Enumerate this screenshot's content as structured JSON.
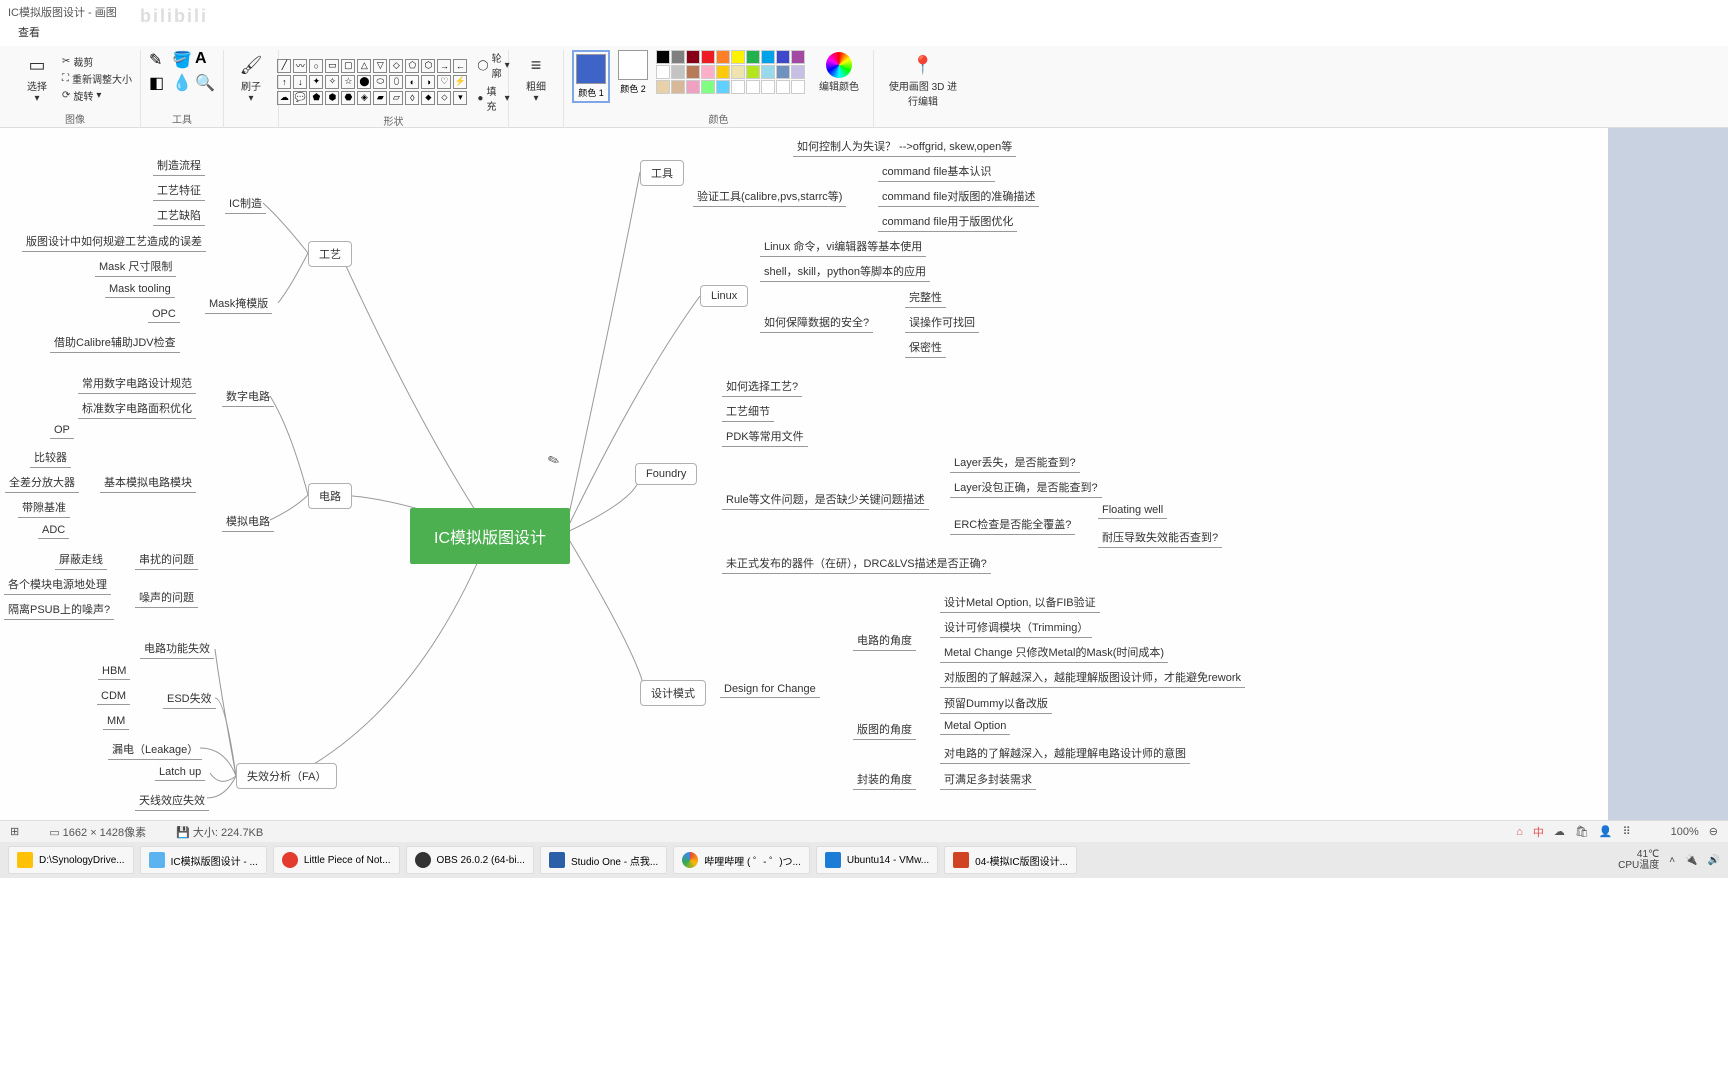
{
  "window": {
    "title": "IC模拟版图设计 - 画图"
  },
  "tabbar": {
    "view": "查看"
  },
  "watermark": "bilibili",
  "ribbon": {
    "image": {
      "label": "图像",
      "select": "选择",
      "crop": "裁剪",
      "resize": "重新调整大小",
      "rotate": "旋转"
    },
    "tools": {
      "label": "工具"
    },
    "shapes": {
      "label": "形状",
      "outline": "轮廓",
      "fill": "填充"
    },
    "brush": {
      "label": "刷子"
    },
    "thickness": {
      "label": "粗细"
    },
    "color1": {
      "heading": "颜色 1",
      "box": "#3e64c8"
    },
    "color2": {
      "heading": "颜色 2",
      "box": "#ffffff"
    },
    "colors": {
      "label": "颜色",
      "edit": "编辑颜色"
    },
    "paint3d": {
      "label": "使用画图 3D 进行编辑"
    }
  },
  "palette": [
    "#000000",
    "#7f7f7f",
    "#880015",
    "#ed1c24",
    "#ff7f27",
    "#fff200",
    "#22b14c",
    "#00a2e8",
    "#3f48cc",
    "#a349a4",
    "#ffffff",
    "#c3c3c3",
    "#b97a57",
    "#ffaec9",
    "#ffc90e",
    "#efe4b0",
    "#b5e61d",
    "#99d9ea",
    "#7092be",
    "#c8bfe7",
    "#e8d0a9",
    "#d7b899",
    "#f0a0c0",
    "#80ff80",
    "#60d0ff",
    "#ffffff",
    "#ffffff",
    "#ffffff",
    "#ffffff",
    "#ffffff"
  ],
  "mindmap": {
    "center": "IC模拟版图设计",
    "left": {
      "gy": {
        "node": "工艺",
        "ic": {
          "label": "IC制造",
          "items": [
            "制造流程",
            "工艺特征",
            "工艺缺陷",
            "版图设计中如何规避工艺造成的误差"
          ]
        },
        "mask": {
          "label": "Mask掩模版",
          "items": [
            "Mask 尺寸限制",
            "Mask tooling",
            "OPC",
            "借助Calibre辅助JDV检查"
          ]
        }
      },
      "dl": {
        "node": "电路",
        "digital": {
          "label": "数字电路",
          "items": [
            "常用数字电路设计规范",
            "标准数字电路面积优化"
          ]
        },
        "analog": {
          "label": "模拟电路",
          "basic": {
            "label": "基本模拟电路模块",
            "items": [
              "OP",
              "比较器",
              "全差分放大器",
              "带隙基准",
              "ADC"
            ]
          },
          "crosstalk": {
            "label": "串扰的问题",
            "items": [
              "屏蔽走线",
              "各个模块电源地处理"
            ]
          },
          "noise": {
            "label": "噪声的问题",
            "items": [
              "隔离PSUB上的噪声?"
            ]
          }
        }
      },
      "fa": {
        "node": "失效分析（FA）",
        "circuit": "电路功能失效",
        "esd": {
          "label": "ESD失效",
          "items": [
            "HBM",
            "CDM",
            "MM"
          ]
        },
        "leak": "漏电（Leakage）",
        "latch": "Latch up",
        "ant": "天线效应失效"
      }
    },
    "right": {
      "tool": {
        "node": "工具",
        "human": "如何控制人为失误？ -->offgrid, skew,open等",
        "verify": {
          "label": "验证工具(calibre,pvs,starrc等)",
          "items": [
            "command file基本认识",
            "command file对版图的准确描述",
            "command file用于版图优化"
          ]
        }
      },
      "linux": {
        "node": "Linux",
        "items": [
          "Linux 命令，vi编辑器等基本使用",
          "shell，skill，python等脚本的应用"
        ],
        "safe": {
          "label": "如何保障数据的安全?",
          "items": [
            "完整性",
            "误操作可找回",
            "保密性"
          ]
        }
      },
      "foundry": {
        "node": "Foundry",
        "items": [
          "如何选择工艺?",
          "工艺细节",
          "PDK等常用文件"
        ],
        "rule": {
          "label": "Rule等文件问题，是否缺少关键问题描述",
          "items": [
            "Layer丢失，是否能查到?",
            "Layer没包正确，是否能查到?"
          ],
          "erc": {
            "label": "ERC检查是否能全覆盖?",
            "items": [
              "Floating well",
              "耐压导致失效能否查到?"
            ]
          }
        },
        "unrel": "未正式发布的器件（在研），DRC&LVS描述是否正确?"
      },
      "mode": {
        "node": "设计模式",
        "dfc": "Design for Change",
        "circ": {
          "label": "电路的角度",
          "items": [
            "设计Metal Option, 以备FIB验证",
            "设计可修调模块（Trimming）",
            "Metal Change 只修改Metal的Mask(时间成本)",
            "对版图的了解越深入，越能理解版图设计师，才能避免rework"
          ]
        },
        "layout": {
          "label": "版图的角度",
          "items": [
            "预留Dummy以备改版",
            "Metal Option",
            "对电路的了解越深入，越能理解电路设计师的意图"
          ]
        },
        "pkg": {
          "label": "封装的角度",
          "items": [
            "可满足多封装需求"
          ]
        }
      }
    }
  },
  "status": {
    "dim": "1662 × 1428像素",
    "size": "大小: 224.7KB",
    "zoom": "100%"
  },
  "taskbar": {
    "items": [
      {
        "label": "D:\\SynologyDrive..."
      },
      {
        "label": "IC模拟版图设计 - ..."
      },
      {
        "label": "Little Piece of Not..."
      },
      {
        "label": "OBS 26.0.2 (64-bi..."
      },
      {
        "label": "Studio One - 点我..."
      },
      {
        "label": "哔哩哔哩 ( ゜- ゜)つ..."
      },
      {
        "label": "Ubuntu14 - VMw..."
      },
      {
        "label": "04-模拟IC版图设计..."
      }
    ],
    "tray": {
      "temp": "41℃",
      "tempLabel": "CPU温度"
    }
  }
}
